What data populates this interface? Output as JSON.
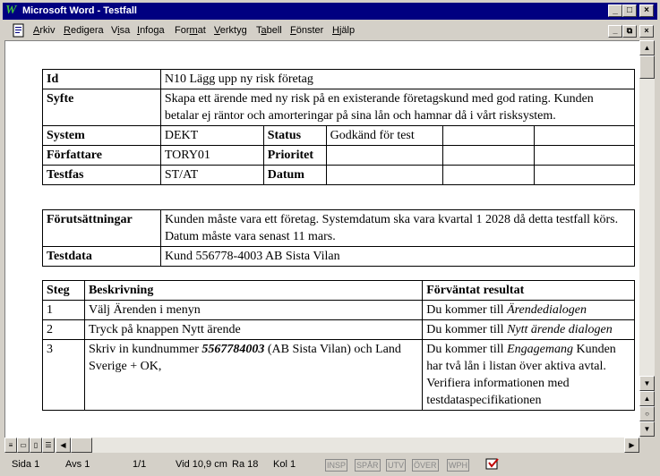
{
  "window": {
    "app_icon": "W",
    "title": "Microsoft Word - Testfall"
  },
  "menu": {
    "items": [
      "Arkiv",
      "Redigera",
      "Visa",
      "Infoga",
      "Format",
      "Verktyg",
      "Tabell",
      "Fönster",
      "Hjälp"
    ],
    "underline_letters": [
      "A",
      "R",
      "i",
      "I",
      "m",
      "V",
      "a",
      "F",
      "H"
    ]
  },
  "table1": {
    "id_label": "Id",
    "id_value": "N10 Lägg upp ny risk företag",
    "syfte_label": "Syfte",
    "syfte_value": "Skapa ett ärende med ny risk på en existerande företagskund med god rating. Kunden betalar ej räntor och amorteringar på sina lån och hamnar då i vårt risksystem.",
    "system_label": "System",
    "system_value": "DEKT",
    "status_label": "Status",
    "status_value": "Godkänd för test",
    "forfattare_label": "Författare",
    "forfattare_value": "TORY01",
    "prioritet_label": "Prioritet",
    "prioritet_value": "",
    "testfas_label": "Testfas",
    "testfas_value": "ST/AT",
    "datum_label": "Datum",
    "datum_value": ""
  },
  "table2": {
    "forutsattningar_label": "Förutsättningar",
    "forutsattningar_value": "Kunden måste vara ett företag. Systemdatum ska vara kvartal 1 2028 då detta testfall körs. Datum måste vara senast 11 mars.",
    "testdata_label": "Testdata",
    "testdata_value": "Kund 556778-4003 AB Sista Vilan"
  },
  "table3": {
    "headers": [
      "Steg",
      "Beskrivning",
      "Förväntat resultat"
    ],
    "rows": [
      {
        "step": "1",
        "desc_pre": "Välj Ärenden i menyn",
        "desc_bold": "",
        "desc_post": "",
        "result_pre": "Du kommer till ",
        "result_italic": "Ärendedialogen",
        "result_post": ""
      },
      {
        "step": "2",
        "desc_pre": "Tryck på knappen Nytt ärende",
        "desc_bold": "",
        "desc_post": "",
        "result_pre": "Du kommer till ",
        "result_italic": "Nytt ärende dialogen",
        "result_post": ""
      },
      {
        "step": "3",
        "desc_pre": "Skriv in kundnummer ",
        "desc_bold": "5567784003",
        "desc_post": " (AB Sista Vilan) och Land Sverige + OK,",
        "result_pre": "Du kommer till ",
        "result_italic": "Engagemang",
        "result_post": " Kunden har två lån i listan över aktiva avtal. Verifiera informationen med testdataspecifikationen"
      }
    ]
  },
  "status": {
    "sida": "Sida 1",
    "avs": "Avs 1",
    "page_of": "1/1",
    "vid": "Vid 10,9 cm",
    "ra": "Ra 18",
    "kol": "Kol 1",
    "modes": [
      "INSP",
      "SPÅR",
      "UTV",
      "ÖVER",
      "WPH"
    ]
  }
}
